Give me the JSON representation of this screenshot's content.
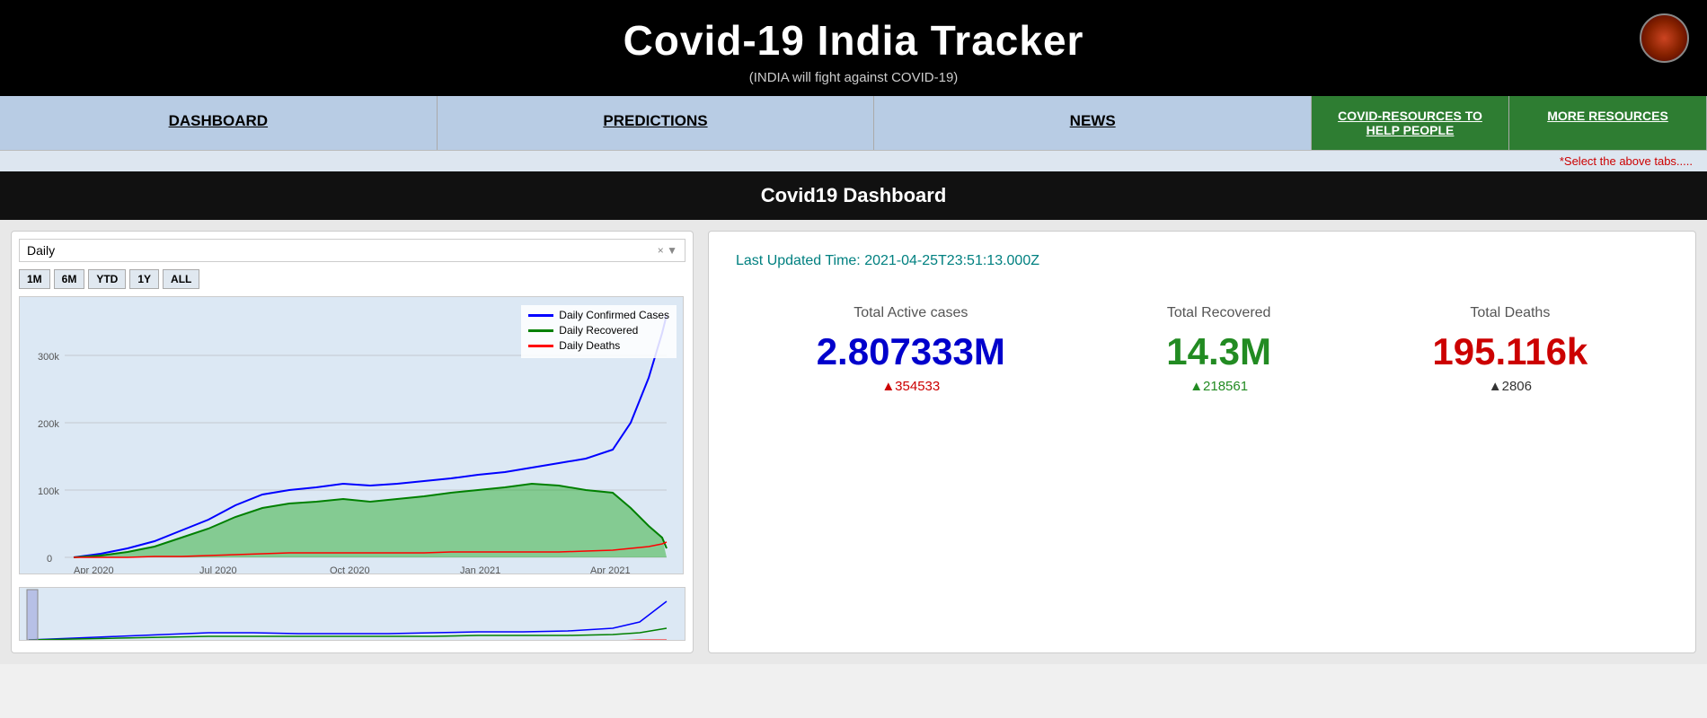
{
  "header": {
    "title": "Covid-19 India Tracker",
    "subtitle": "(INDIA will fight against COVID-19)"
  },
  "nav": {
    "items": [
      {
        "label": "DASHBOARD",
        "type": "default"
      },
      {
        "label": "PREDICTIONS",
        "type": "default"
      },
      {
        "label": "NEWS",
        "type": "default"
      },
      {
        "label": "COVID-RESOURCES TO HELP PEOPLE",
        "type": "green"
      },
      {
        "label": "MORE RESOURCES",
        "type": "green"
      }
    ],
    "hint": "*Select the above tabs....."
  },
  "dashboard": {
    "title": "Covid19 Dashboard",
    "chart": {
      "dropdown_label": "Daily",
      "time_buttons": [
        "1M",
        "6M",
        "YTD",
        "1Y",
        "ALL"
      ],
      "legend": [
        {
          "label": "Daily Confirmed Cases",
          "color": "#0000ff"
        },
        {
          "label": "Daily Recovered",
          "color": "#008000"
        },
        {
          "label": "Daily Deaths",
          "color": "#ff0000"
        }
      ],
      "x_labels": [
        "Apr 2020",
        "Jul 2020",
        "Oct 2020",
        "Jan 2021",
        "Apr 2021"
      ],
      "y_labels": [
        "0",
        "100k",
        "200k",
        "300k"
      ]
    },
    "stats": {
      "last_updated": "Last Updated Time: 2021-04-25T23:51:13.000Z",
      "active_label": "Total Active cases",
      "active_value": "2.807333M",
      "active_delta": "▲354533",
      "recovered_label": "Total Recovered",
      "recovered_value": "14.3M",
      "recovered_delta": "▲218561",
      "deaths_label": "Total Deaths",
      "deaths_value": "195.116k",
      "deaths_delta": "▲2806"
    }
  }
}
